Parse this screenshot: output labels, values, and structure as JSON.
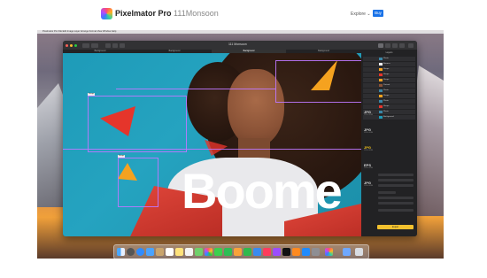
{
  "header": {
    "brand_bold": "Pixelmator Pro",
    "brand_light": "111Monsoon",
    "explore_label": "Explore ⌄",
    "buy_label": "Buy"
  },
  "mac": {
    "menu_items": "Pixelmator Pro   File   Edit   Image   Layer   Arrange   Format   View   Window   Help"
  },
  "app": {
    "document_title": "111 Monsoon",
    "tabs": [
      "Background",
      "Background",
      "Background",
      "Background"
    ],
    "canvas_text": "Boome",
    "layers_title": "Layers",
    "layers": [
      {
        "name": "Photo"
      },
      {
        "name": "Boomer"
      },
      {
        "name": "Shape"
      },
      {
        "name": "Shape"
      },
      {
        "name": "Shape"
      },
      {
        "name": "Portrait"
      },
      {
        "name": "Photo"
      },
      {
        "name": "Shape"
      },
      {
        "name": "Photo"
      },
      {
        "name": "Shape"
      },
      {
        "name": "Photo"
      },
      {
        "name": "Background"
      }
    ],
    "formats": [
      {
        "name": "JPG",
        "sub": "1920×1080",
        "highlight": false
      },
      {
        "name": "JPG",
        "sub": "1920×1080",
        "highlight": false
      },
      {
        "name": "JPG",
        "sub": "1920×1080",
        "highlight": true
      },
      {
        "name": "EPS",
        "sub": "1920×1080",
        "highlight": false
      },
      {
        "name": "JPG",
        "sub": "1920×1080",
        "highlight": false
      }
    ],
    "export_button": "Export"
  },
  "colors": {
    "canvas_bg": "#1e9bb8",
    "accent_orange": "#f5a21f",
    "accent_red": "#e5352b",
    "export_yellow": "#f2c12e",
    "buy_blue": "#1a73e8"
  },
  "dock_icons": [
    "finder-icon",
    "launchpad-icon",
    "safari-icon",
    "mail-icon",
    "contacts-icon",
    "calendar-icon",
    "notes-icon",
    "reminders-icon",
    "maps-icon",
    "photos-icon",
    "messages-icon",
    "facetime-icon",
    "pages-icon",
    "numbers-icon",
    "keynote-icon",
    "music-icon",
    "podcasts-icon",
    "tv-icon",
    "books-icon",
    "appstore-icon",
    "settings-icon",
    "pixelmator-icon",
    "downloads-icon",
    "trash-icon"
  ]
}
